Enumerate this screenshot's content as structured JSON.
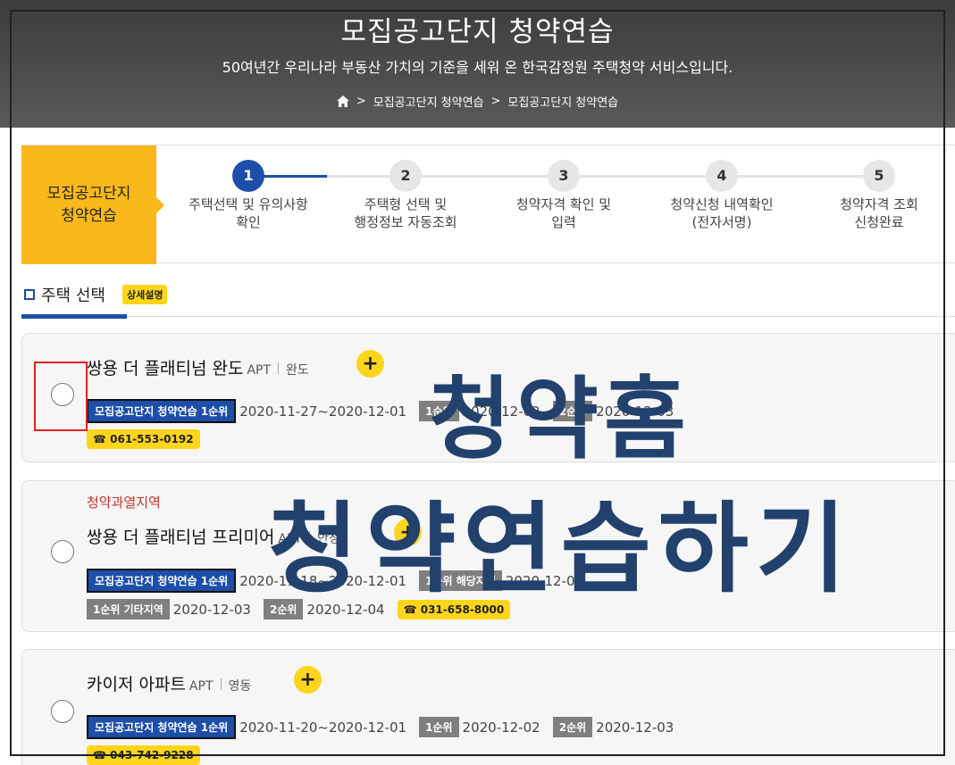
{
  "header": {
    "title": "모집공고단지 청약연습",
    "subtitle": "50여년간 우리나라 부동산 가치의 기준을 세워 온 한국감정원 주택청약 서비스입니다.",
    "breadcrumb": [
      "모집공고단지 청약연습",
      "모집공고단지 청약연습"
    ]
  },
  "stepper": {
    "label": "모집공고단지\n청약연습",
    "steps": [
      {
        "num": "1",
        "label": "주택선택 및 유의사항\n확인"
      },
      {
        "num": "2",
        "label": "주택형 선택 및\n행정정보 자동조회"
      },
      {
        "num": "3",
        "label": "청약자격 확인 및\n입력"
      },
      {
        "num": "4",
        "label": "청약신청 내역확인\n(전자서명)"
      },
      {
        "num": "5",
        "label": "청약자격 조회\n신청완료"
      }
    ],
    "current_step": 1
  },
  "section": {
    "title": "주택 선택",
    "detail_button": "상세설명"
  },
  "listings": [
    {
      "region": "",
      "name": "쌍용 더 플래티넘 완도",
      "type": "APT",
      "location": "완도",
      "badge": "모집공고단지 청약연습 1순위",
      "period": "2020-11-27~2020-12-01",
      "rank1_label": "1순위",
      "rank1_date": "2020-12-02",
      "rank2_label": "2순위",
      "rank2_date": "2020-12-03",
      "phone": "☎ 061-553-0192"
    },
    {
      "region": "청약과열지역",
      "name": "쌍용 더 플래티넘 프리미어",
      "type": "APT",
      "location": "안성",
      "badge": "모집공고단지 청약연습 1순위",
      "period": "2020-11-18~2020-12-01",
      "rank1_label": "1순위 해당지역",
      "rank1_date": "2020-12-02",
      "rank1b_label": "1순위 기타지역",
      "rank1b_date": "2020-12-03",
      "rank2_label": "2순위",
      "rank2_date": "2020-12-04",
      "phone": "☎ 031-658-8000"
    },
    {
      "region": "",
      "name": "카이저 아파트",
      "type": "APT",
      "location": "영동",
      "badge": "모집공고단지 청약연습 1순위",
      "period": "2020-11-20~2020-12-01",
      "rank1_label": "1순위",
      "rank1_date": "2020-12-02",
      "rank2_label": "2순위",
      "rank2_date": "2020-12-03",
      "phone": "☎ 043-742-9228"
    }
  ],
  "plus_label": "+",
  "watermark": {
    "line1": "청약홈",
    "line2": "청약연습하기"
  },
  "colors": {
    "accent_blue": "#1d4ea8",
    "accent_yellow": "#f9b81b",
    "badge_yellow": "#ffd51c",
    "region_red": "#c4342c",
    "watermark": "#22416d"
  }
}
